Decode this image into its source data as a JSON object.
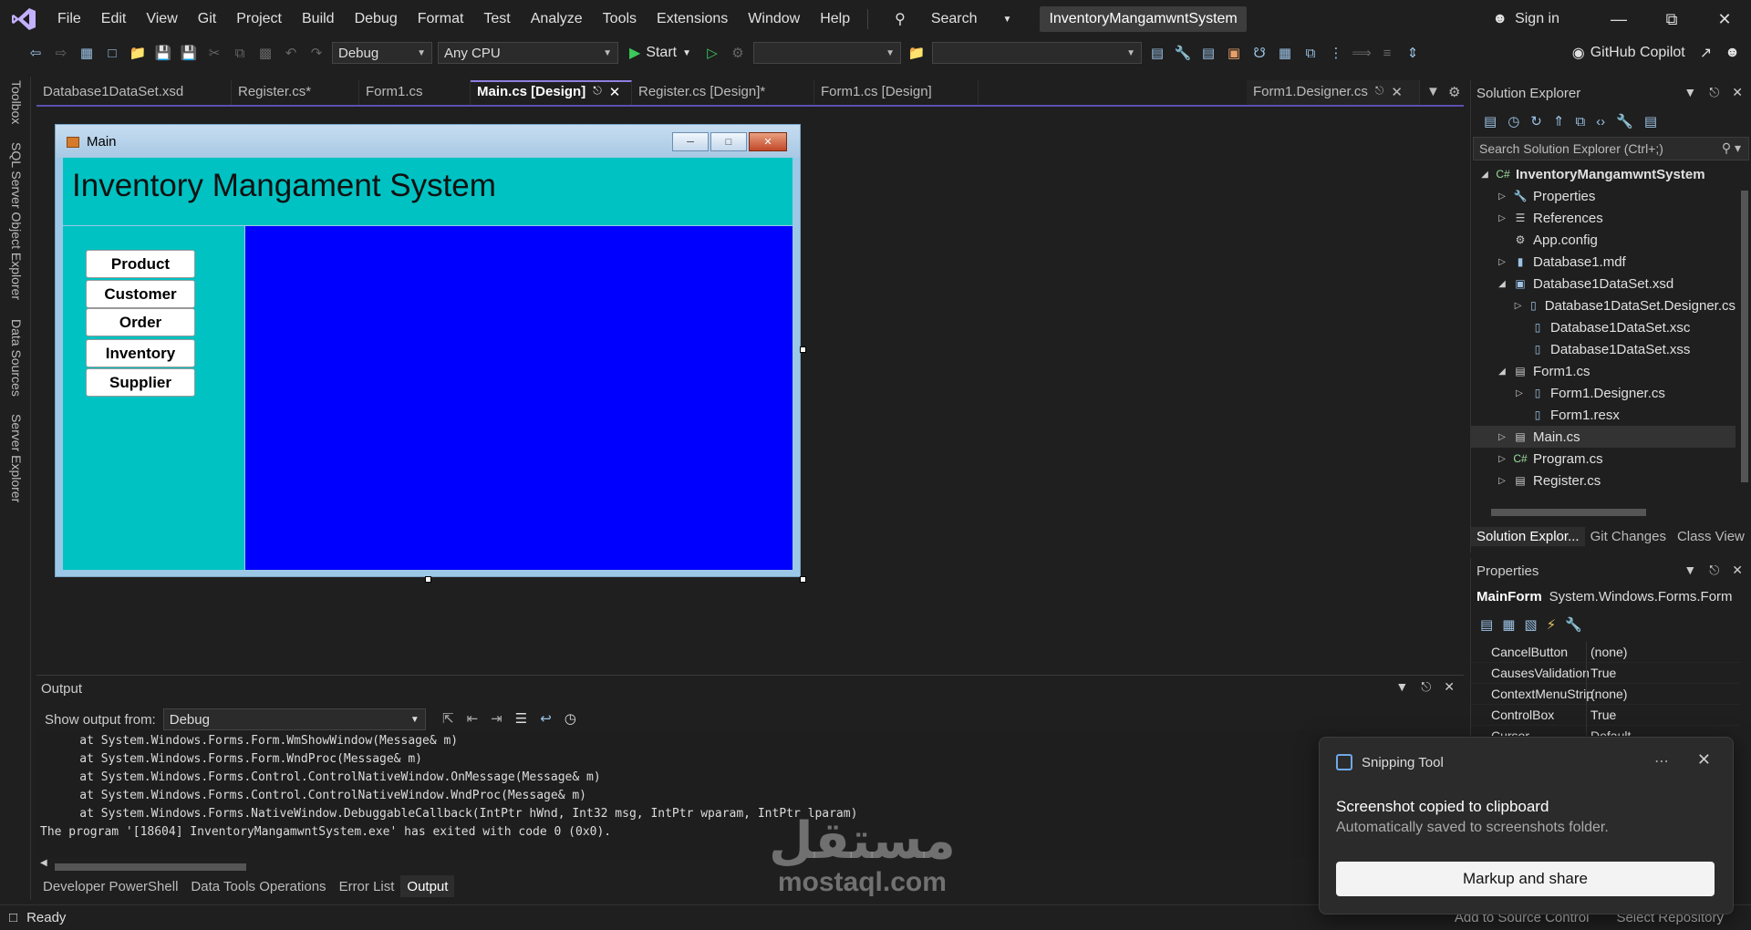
{
  "menubar": {
    "items": [
      "File",
      "Edit",
      "View",
      "Git",
      "Project",
      "Build",
      "Debug",
      "Format",
      "Test",
      "Analyze",
      "Tools",
      "Extensions",
      "Window",
      "Help"
    ],
    "search_label": "Search",
    "project_name": "InventoryMangamwntSystem",
    "signin_label": "Sign in"
  },
  "toolbar": {
    "config": "Debug",
    "platform": "Any CPU",
    "start_label": "Start",
    "copilot_label": "GitHub Copilot"
  },
  "side_strip": [
    "Toolbox",
    "SQL Server Object Explorer",
    "Data Sources",
    "Server Explorer"
  ],
  "doc_tabs": [
    {
      "label": "Database1DataSet.xsd",
      "active": false
    },
    {
      "label": "Register.cs*",
      "active": false
    },
    {
      "label": "Form1.cs",
      "active": false
    },
    {
      "label": "Main.cs [Design]",
      "active": true
    },
    {
      "label": "Register.cs [Design]*",
      "active": false
    },
    {
      "label": "Form1.cs [Design]",
      "active": false
    },
    {
      "label": "Form1.Designer.cs",
      "active": false
    }
  ],
  "form": {
    "window_title": "Main",
    "header_title": "Inventory Mangament System",
    "nav_buttons": [
      "Product",
      "Customer",
      "Order",
      "Inventory",
      "Supplier"
    ],
    "colors": {
      "header": "#00c2c2",
      "main_panel": "#0000ff"
    }
  },
  "output": {
    "title": "Output",
    "show_from_label": "Show output from:",
    "show_from_value": "Debug",
    "lines": [
      "    at System.Windows.Forms.Form.WmShowWindow(Message& m)",
      "    at System.Windows.Forms.Form.WndProc(Message& m)",
      "    at System.Windows.Forms.Control.ControlNativeWindow.OnMessage(Message& m)",
      "    at System.Windows.Forms.Control.ControlNativeWindow.WndProc(Message& m)",
      "    at System.Windows.Forms.NativeWindow.DebuggableCallback(IntPtr hWnd, Int32 msg, IntPtr wparam, IntPtr lparam)",
      "The program '[18604] InventoryMangamwntSystem.exe' has exited with code 0 (0x0)."
    ]
  },
  "bottom_tabs": [
    {
      "label": "Developer PowerShell",
      "active": false
    },
    {
      "label": "Data Tools Operations",
      "active": false
    },
    {
      "label": "Error List",
      "active": false
    },
    {
      "label": "Output",
      "active": true
    }
  ],
  "statusbar": {
    "ready": "Ready",
    "add_source_control": "Add to Source Control",
    "select_repo": "Select Repository"
  },
  "solution_explorer": {
    "title": "Solution Explorer",
    "search_placeholder": "Search Solution Explorer (Ctrl+;)",
    "nodes": [
      {
        "label": "InventoryMangamwntSystem",
        "depth": 0,
        "expander": "open",
        "icon": "csharp-project-icon",
        "bold": true,
        "selected": false
      },
      {
        "label": "Properties",
        "depth": 1,
        "expander": "closed",
        "icon": "wrench-icon",
        "bold": false,
        "selected": false
      },
      {
        "label": "References",
        "depth": 1,
        "expander": "closed",
        "icon": "references-icon",
        "bold": false,
        "selected": false
      },
      {
        "label": "App.config",
        "depth": 1,
        "expander": "none",
        "icon": "config-icon",
        "bold": false,
        "selected": false
      },
      {
        "label": "Database1.mdf",
        "depth": 1,
        "expander": "closed",
        "icon": "database-icon",
        "bold": false,
        "selected": false
      },
      {
        "label": "Database1DataSet.xsd",
        "depth": 1,
        "expander": "open",
        "icon": "dataset-icon",
        "bold": false,
        "selected": false
      },
      {
        "label": "Database1DataSet.Designer.cs",
        "depth": 2,
        "expander": "closed",
        "icon": "file-icon",
        "bold": false,
        "selected": false
      },
      {
        "label": "Database1DataSet.xsc",
        "depth": 2,
        "expander": "none",
        "icon": "file-icon",
        "bold": false,
        "selected": false
      },
      {
        "label": "Database1DataSet.xss",
        "depth": 2,
        "expander": "none",
        "icon": "file-icon",
        "bold": false,
        "selected": false
      },
      {
        "label": "Form1.cs",
        "depth": 1,
        "expander": "open",
        "icon": "form-icon",
        "bold": false,
        "selected": false
      },
      {
        "label": "Form1.Designer.cs",
        "depth": 2,
        "expander": "closed",
        "icon": "file-icon",
        "bold": false,
        "selected": false
      },
      {
        "label": "Form1.resx",
        "depth": 2,
        "expander": "none",
        "icon": "file-icon",
        "bold": false,
        "selected": false
      },
      {
        "label": "Main.cs",
        "depth": 1,
        "expander": "closed",
        "icon": "form-icon",
        "bold": false,
        "selected": true
      },
      {
        "label": "Program.cs",
        "depth": 1,
        "expander": "closed",
        "icon": "csharp-file-icon",
        "bold": false,
        "selected": false
      },
      {
        "label": "Register.cs",
        "depth": 1,
        "expander": "closed",
        "icon": "form-icon",
        "bold": false,
        "selected": false
      }
    ],
    "bottom_tabs": [
      {
        "label": "Solution Explor...",
        "active": true
      },
      {
        "label": "Git Changes",
        "active": false
      },
      {
        "label": "Class View",
        "active": false
      }
    ]
  },
  "properties": {
    "title": "Properties",
    "object_name": "MainForm",
    "object_type": "System.Windows.Forms.Form",
    "rows": [
      {
        "name": "CancelButton",
        "value": "(none)"
      },
      {
        "name": "CausesValidation",
        "value": "True"
      },
      {
        "name": "ContextMenuStrip",
        "value": "(none)"
      },
      {
        "name": "ControlBox",
        "value": "True"
      },
      {
        "name": "Cursor",
        "value": "Default"
      }
    ]
  },
  "toast": {
    "app": "Snipping Tool",
    "message": "Screenshot copied to clipboard",
    "sub": "Automatically saved to screenshots folder.",
    "action": "Markup and share"
  },
  "watermark": {
    "arabic": "مستقل",
    "latin": "mostaql.com"
  }
}
